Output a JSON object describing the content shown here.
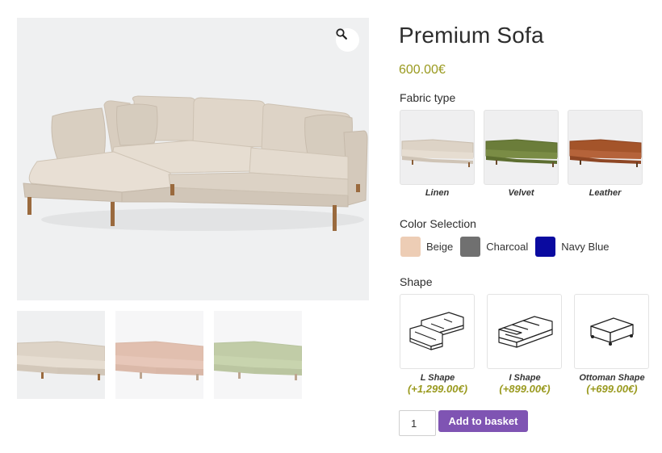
{
  "product": {
    "title": "Premium Sofa",
    "price": "600.00€"
  },
  "gallery": {
    "zoom_icon": "magnifier-icon",
    "main_fabric": "beige",
    "thumbnails": [
      {
        "name": "linen",
        "color": "#e2d8cc",
        "active": true
      },
      {
        "name": "blush",
        "color": "#dcb9ab",
        "active": false
      },
      {
        "name": "sage",
        "color": "#c6cfae",
        "active": false
      }
    ]
  },
  "fabric": {
    "label": "Fabric type",
    "options": [
      {
        "label": "Linen",
        "color": "#ddd3c6"
      },
      {
        "label": "Velvet",
        "color": "#6b7d3a"
      },
      {
        "label": "Leather",
        "color": "#a4542a"
      }
    ]
  },
  "color": {
    "label": "Color Selection",
    "options": [
      {
        "label": "Beige",
        "color": "#edcdb5"
      },
      {
        "label": "Charcoal",
        "color": "#707070"
      },
      {
        "label": "Navy Blue",
        "color": "#0a0aa0"
      }
    ]
  },
  "shape": {
    "label": "Shape",
    "options": [
      {
        "label": "L Shape",
        "price": "(+1,299.00€)",
        "icon": "l-shape-sofa-icon"
      },
      {
        "label": "I Shape",
        "price": "(+899.00€)",
        "icon": "i-shape-sofa-icon"
      },
      {
        "label": "Ottoman Shape",
        "price": "(+699.00€)",
        "icon": "ottoman-icon"
      }
    ]
  },
  "cart": {
    "quantity": "1",
    "add_label": "Add to basket",
    "accent": "#7f54b3"
  }
}
